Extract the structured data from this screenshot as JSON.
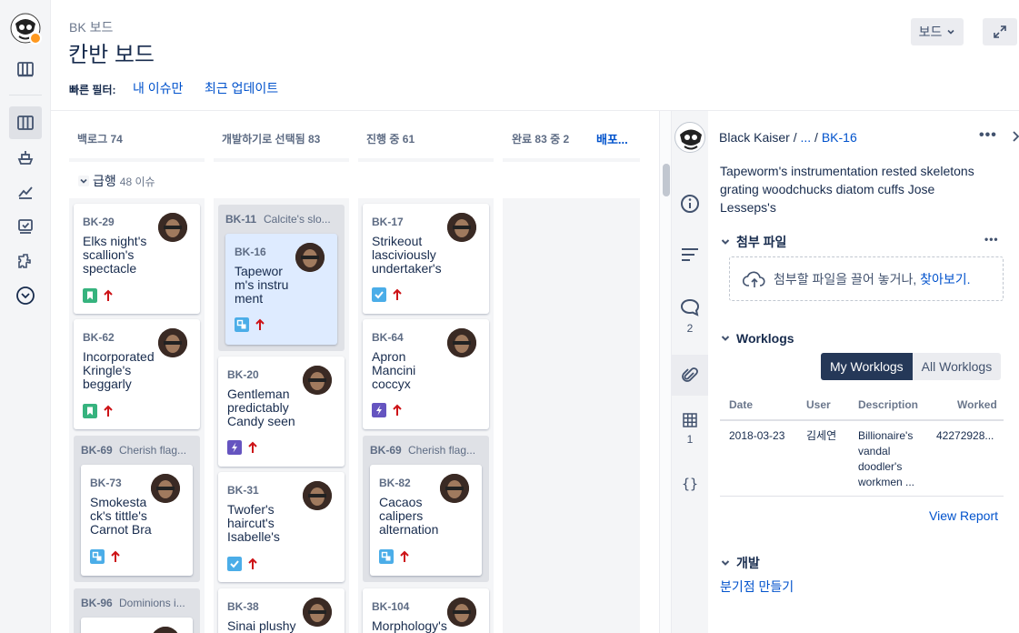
{
  "header": {
    "breadcrumb": "BK 보드",
    "title": "칸반 보드",
    "board_button": "보드",
    "quick_filters_label": "빠른 필터:",
    "quick_filters": [
      "내 이슈만",
      "최근 업데이트"
    ]
  },
  "columns": [
    {
      "name": "백로그 74"
    },
    {
      "name": "개발하기로 선택됨 83"
    },
    {
      "name": "진행 중 61"
    },
    {
      "name": "완료 83 중 2",
      "action": "배포..."
    }
  ],
  "swimlane": {
    "label": "급행",
    "count": "48 이슈"
  },
  "cards": {
    "bk29": {
      "key": "BK-29",
      "summary": "Elks night's scallion's spectacle",
      "type": "story"
    },
    "bk62": {
      "key": "BK-62",
      "summary": "Incorporated Kringle's beggarly",
      "type": "story"
    },
    "bk69a": {
      "key": "BK-69",
      "summary": "Cherish flag..."
    },
    "bk73": {
      "key": "BK-73",
      "summary": "Smokestack's tittle's Carnot Brant'..."
    },
    "bk96": {
      "key": "BK-96",
      "summary": "Dominions i..."
    },
    "bk11": {
      "key": "BK-11",
      "summary": "Calcite's slo..."
    },
    "bk16": {
      "key": "BK-16",
      "summary": "Tapeworm's instrument"
    },
    "bk20": {
      "key": "BK-20",
      "summary": "Gentleman predictably Candy seen"
    },
    "bk31": {
      "key": "BK-31",
      "summary": "Twofer's haircut's Isabelle's"
    },
    "bk38": {
      "key": "BK-38",
      "summary": "Sinai plushy"
    },
    "bk17": {
      "key": "BK-17",
      "summary": "Strikeout lasciviously undertaker's"
    },
    "bk64": {
      "key": "BK-64",
      "summary": "Apron Mancini coccyx"
    },
    "bk69b": {
      "key": "BK-69",
      "summary": "Cherish flag..."
    },
    "bk82": {
      "key": "BK-82",
      "summary": "Cacaos calipers alternation"
    },
    "bk104": {
      "key": "BK-104",
      "summary": "Morphology's"
    }
  },
  "detail": {
    "project": "Black Kaiser",
    "sep": "/",
    "ellipsis": "...",
    "issue_key": "BK-16",
    "summary": "Tapeworm's instrumentation rested skeletons grating woodchucks diatom cuffs Jose Lesseps's",
    "comments_count": "2",
    "table_count": "1",
    "attachments_title": "첨부 파일",
    "dropzone_text": "첨부할 파일을 끌어 놓거나,",
    "dropzone_link": "찾아보기.",
    "worklogs_title": "Worklogs",
    "my_worklogs": "My Worklogs",
    "all_worklogs": "All Worklogs",
    "table_headers": {
      "date": "Date",
      "user": "User",
      "description": "Description",
      "worked": "Worked"
    },
    "worklog_row": {
      "date": "2018-03-23",
      "user": "김세연",
      "description": "Billionaire's vandal doodler's workmen ...",
      "worked": "42272928..."
    },
    "view_report": "View Report",
    "dev_title": "개발",
    "create_branch": "분기점 만들기"
  }
}
